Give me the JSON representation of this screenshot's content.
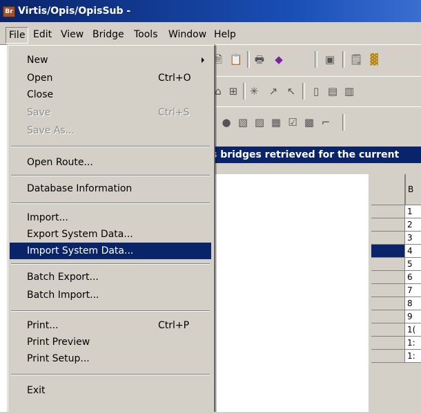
{
  "app": {
    "title": "Virtis/Opis/OpisSub -",
    "icon_text": "Br"
  },
  "menubar": [
    {
      "label": "File"
    },
    {
      "label": "Edit"
    },
    {
      "label": "View"
    },
    {
      "label": "Bridge"
    },
    {
      "label": "Tools"
    },
    {
      "label": "Window"
    },
    {
      "label": "Help"
    }
  ],
  "file_menu": {
    "items": [
      {
        "label": "New",
        "shortcut": "",
        "submenu": true
      },
      {
        "label": "Open",
        "shortcut": "Ctrl+O"
      },
      {
        "label": "Close",
        "shortcut": ""
      },
      {
        "label": "Save",
        "shortcut": "Ctrl+S",
        "disabled": true
      },
      {
        "label": "Save As...",
        "shortcut": "",
        "disabled": true
      },
      {
        "label": "Open Route...",
        "shortcut": ""
      },
      {
        "label": "Database Information",
        "shortcut": ""
      },
      {
        "label": "Import...",
        "shortcut": ""
      },
      {
        "label": "Export System Data...",
        "shortcut": ""
      },
      {
        "label": "Import System Data...",
        "shortcut": "",
        "highlighted": true
      },
      {
        "label": "Batch Export...",
        "shortcut": ""
      },
      {
        "label": "Batch Import...",
        "shortcut": ""
      },
      {
        "label": "Print...",
        "shortcut": "Ctrl+P"
      },
      {
        "label": "Print Preview",
        "shortcut": ""
      },
      {
        "label": "Print Setup...",
        "shortcut": ""
      },
      {
        "label": "Exit",
        "shortcut": ""
      }
    ]
  },
  "infobar": {
    "text": "s bridges retrieved for the current"
  },
  "grid": {
    "header": "B",
    "rows": [
      "1",
      "2",
      "3",
      "4",
      "5",
      "6",
      "7",
      "8",
      "9",
      "1(",
      "1:",
      "1:"
    ],
    "selected_row_index": 3
  },
  "colors": {
    "highlight": "#0a246a",
    "face": "#d4d0c8"
  }
}
